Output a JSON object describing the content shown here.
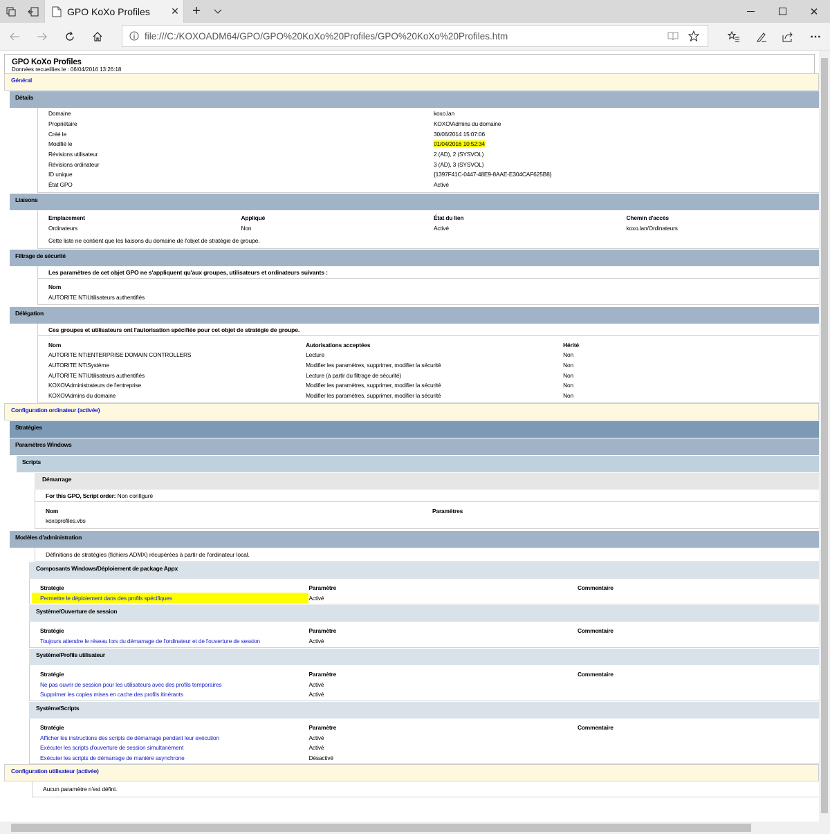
{
  "browser": {
    "tab_title": "GPO KoXo Profiles",
    "url": "file:///C:/KOXOADM64/GPO/GPO%20KoXo%20Profiles/GPO%20KoXo%20Profiles.htm"
  },
  "report": {
    "title": "GPO KoXo Profiles",
    "collected": "Données recueillies le : 06/04/2016 13:26:18",
    "general": "Général",
    "details": {
      "heading": "Détails",
      "rows": [
        [
          "Domaine",
          "koxo.lan"
        ],
        [
          "Propriétaire",
          "KOXO\\Admins du domaine"
        ],
        [
          "Créé le",
          "30/06/2014 15:07:06"
        ],
        [
          "Modifié le",
          "01/04/2016 10:52:34"
        ],
        [
          "Révisions utilisateur",
          "2 (AD), 2 (SYSVOL)"
        ],
        [
          "Révisions ordinateur",
          "3 (AD), 3 (SYSVOL)"
        ],
        [
          "ID unique",
          "{1397F41C-0447-48E9-8AAE-E304CAF625B8}"
        ],
        [
          "État GPO",
          "Activé"
        ]
      ]
    },
    "links": {
      "heading": "Liaisons",
      "columns": [
        "Emplacement",
        "Appliqué",
        "État du lien",
        "Chemin d'accès"
      ],
      "rows": [
        [
          "Ordinateurs",
          "Non",
          "Activé",
          "koxo.lan/Ordinateurs"
        ]
      ],
      "note": "Cette liste ne contient que les liaisons du domaine de l'objet de stratégie de groupe."
    },
    "security": {
      "heading": "Filtrage de sécurité",
      "intro": "Les paramètres de cet objet GPO ne s'appliquent qu'aux groupes, utilisateurs et ordinateurs suivants :",
      "column": "Nom",
      "rows": [
        "AUTORITE NT\\Utilisateurs authentifiés"
      ]
    },
    "delegation": {
      "heading": "Délégation",
      "intro": "Ces groupes et utilisateurs ont l'autorisation spécifiée pour cet objet de stratégie de groupe.",
      "columns": [
        "Nom",
        "Autorisations acceptées",
        "Hérité"
      ],
      "rows": [
        [
          "AUTORITE NT\\ENTERPRISE DOMAIN CONTROLLERS",
          "Lecture",
          "Non"
        ],
        [
          "AUTORITE NT\\Système",
          "Modifier les paramètres, supprimer, modifier la sécurité",
          "Non"
        ],
        [
          "AUTORITE NT\\Utilisateurs authentifiés",
          "Lecture (à partir du filtrage de sécurité)",
          "Non"
        ],
        [
          "KOXO\\Administrateurs de l'entreprise",
          "Modifier les paramètres, supprimer, modifier la sécurité",
          "Non"
        ],
        [
          "KOXO\\Admins du domaine",
          "Modifier les paramètres, supprimer, modifier la sécurité",
          "Non"
        ]
      ]
    },
    "computer_config": {
      "heading": "Configuration ordinateur (activée)",
      "strategies": "Stratégies",
      "windows_settings": "Paramètres Windows",
      "scripts": "Scripts",
      "startup": "Démarrage",
      "script_order_label": "For this GPO, Script order:",
      "script_order_value": "Non configuré",
      "script_columns": [
        "Nom",
        "Paramètres"
      ],
      "script_rows": [
        [
          "koxoprofiles.vbs",
          ""
        ]
      ],
      "admin_templates": "Modèles d'administration",
      "admx_note": "Définitions de stratégies (fichiers ADMX) récupérées à partir de l'ordinateur local.",
      "policy_columns": [
        "Stratégie",
        "Paramètre",
        "Commentaire"
      ],
      "groups": [
        {
          "heading": "Composants Windows/Déploiement de package Appx",
          "rows": [
            [
              "Permettre le déploiement dans des profils spécifiques",
              "Activé",
              ""
            ]
          ]
        },
        {
          "heading": "Système/Ouverture de session",
          "rows": [
            [
              "Toujours attendre le réseau lors du démarrage de l'ordinateur et de l'ouverture de session",
              "Activé",
              ""
            ]
          ]
        },
        {
          "heading": "Système/Profils utilisateur",
          "rows": [
            [
              "Ne pas ouvrir de session pour les utilisateurs avec des profils temporaires",
              "Activé",
              ""
            ],
            [
              "Supprimer les copies mises en cache des profils itinérants",
              "Activé",
              ""
            ]
          ]
        },
        {
          "heading": "Système/Scripts",
          "rows": [
            [
              "Afficher les instructions des scripts de démarrage pendant leur exécution",
              "Activé",
              ""
            ],
            [
              "Exécuter les scripts d'ouverture de session simultanément",
              "Activé",
              ""
            ],
            [
              "Exécuter les scripts de démarrage de manière asynchrone",
              "Désactivé",
              ""
            ]
          ]
        }
      ]
    },
    "user_config": {
      "heading": "Configuration utilisateur (activée)",
      "note": "Aucun paramètre n'est défini."
    }
  },
  "highlight_color": "#ffff00",
  "link_color": "#1a23c8"
}
